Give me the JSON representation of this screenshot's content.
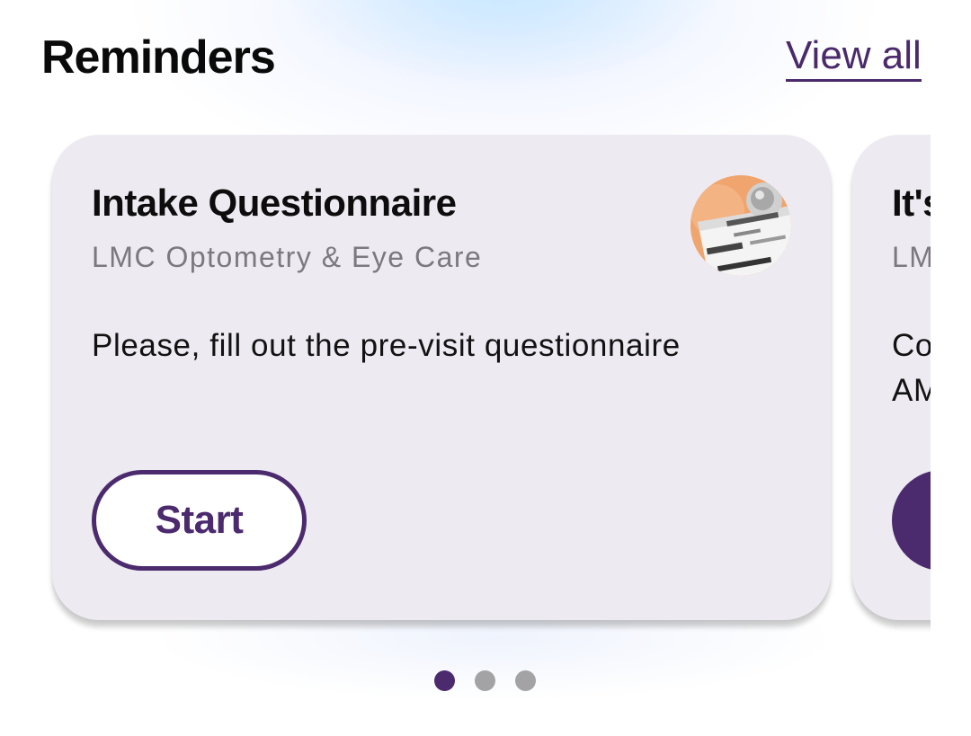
{
  "header": {
    "title": "Reminders",
    "view_all_label": "View all"
  },
  "reminders": [
    {
      "title": "Intake Questionnaire",
      "provider": "LMC Optometry & Eye Care",
      "message": "Please, fill out the pre-visit questionnaire",
      "action_label": "Start",
      "avatar_icon": "clinic-avatar-icon"
    },
    {
      "title": "It's",
      "provider": "LM",
      "message": "Co AM",
      "action_label": ""
    }
  ],
  "pagination": {
    "total_pages": 3,
    "current_page": 1
  },
  "colors": {
    "accent": "#4b2a6e",
    "card_background": "#edeaf1",
    "subtitle_text": "#7b7880",
    "inactive_dot": "#a3a3a5"
  }
}
